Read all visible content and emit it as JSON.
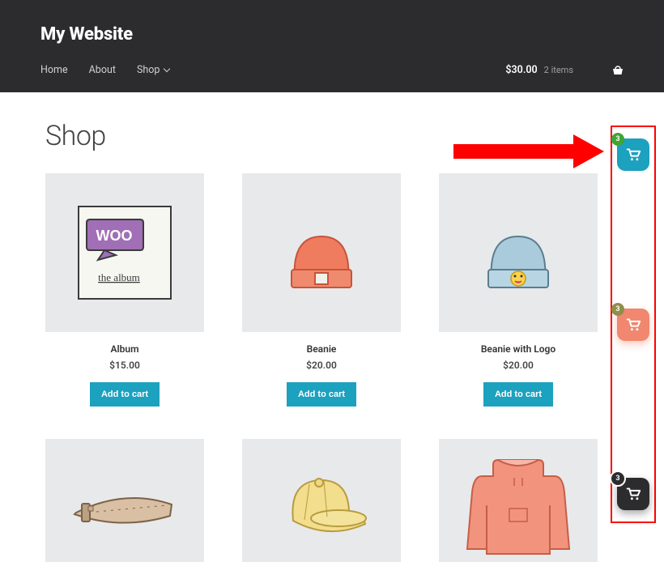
{
  "header": {
    "site_title": "My Website",
    "nav": [
      "Home",
      "About",
      "Shop"
    ],
    "cart_total": "$30.00",
    "cart_items_label": "2 items"
  },
  "page": {
    "title": "Shop"
  },
  "products": [
    {
      "title": "Album",
      "price": "$15.00",
      "button": "Add to cart"
    },
    {
      "title": "Beanie",
      "price": "$20.00",
      "button": "Add to cart"
    },
    {
      "title": "Beanie with Logo",
      "price": "$20.00",
      "button": "Add to cart"
    },
    {
      "title": "",
      "price": "",
      "button": ""
    },
    {
      "title": "",
      "price": "",
      "button": ""
    },
    {
      "title": "",
      "price": "",
      "button": ""
    }
  ],
  "fabs": [
    {
      "badge": "3",
      "color": "blue",
      "badge_color": "green"
    },
    {
      "badge": "3",
      "color": "coral",
      "badge_color": "olive"
    },
    {
      "badge": "3",
      "color": "dark",
      "badge_color": "black"
    }
  ]
}
